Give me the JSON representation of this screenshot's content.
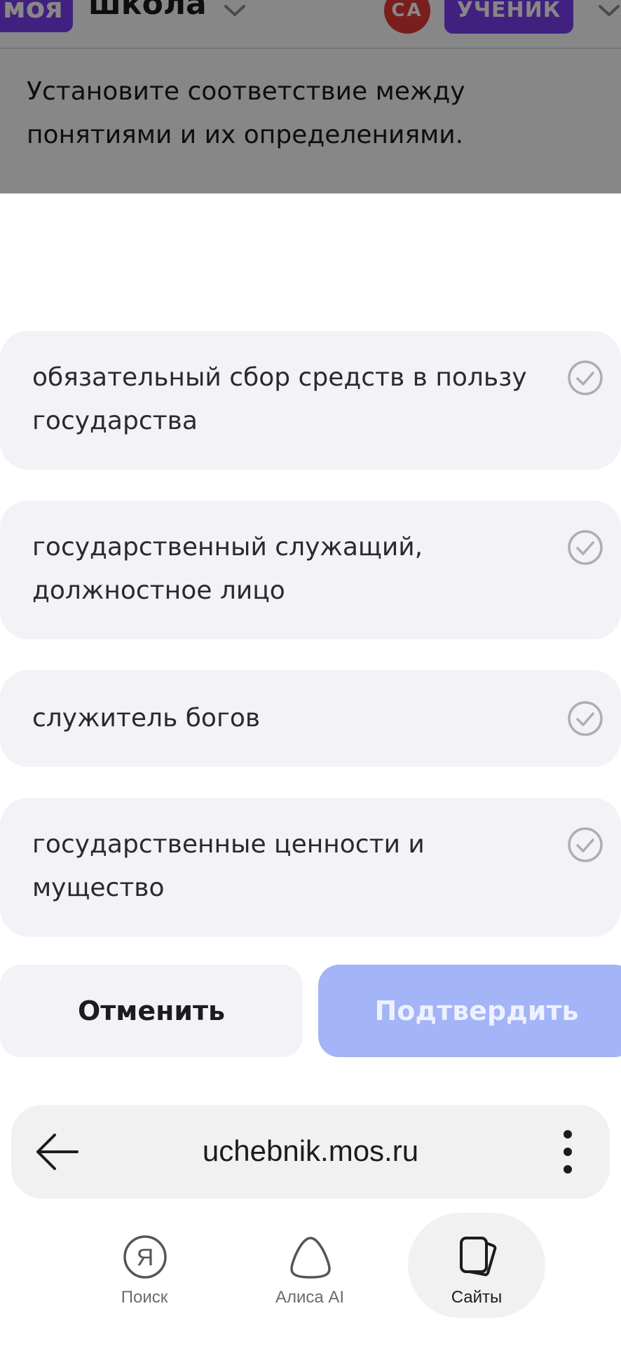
{
  "app_header": {
    "logo_part1": "моя",
    "logo_part2": "школа",
    "avatar_initials": "СА",
    "role_badge": "УЧЕНИК"
  },
  "task": {
    "instruction": "Установите соответствие между понятиями и их определениями."
  },
  "options": [
    {
      "text": "обязательный сбор средств в пользу государства"
    },
    {
      "text": "государственный служащий, должностное лицо"
    },
    {
      "text": "служитель богов"
    },
    {
      "text": "государственные ценности и мущество"
    }
  ],
  "actions": {
    "cancel_label": "Отменить",
    "confirm_label": "Подтвердить"
  },
  "browser": {
    "url": "uchebnik.mos.ru",
    "tabs": [
      {
        "label": "Поиск",
        "icon": "yandex-search-icon"
      },
      {
        "label": "Алиса AI",
        "icon": "alice-icon"
      },
      {
        "label": "Сайты",
        "icon": "sites-icon",
        "active": true
      }
    ]
  },
  "colors": {
    "brand_purple": "#7b3ff2",
    "avatar_red": "#e53935",
    "confirm_disabled": "#a3b4f7",
    "option_bg": "#f2f2f7"
  }
}
